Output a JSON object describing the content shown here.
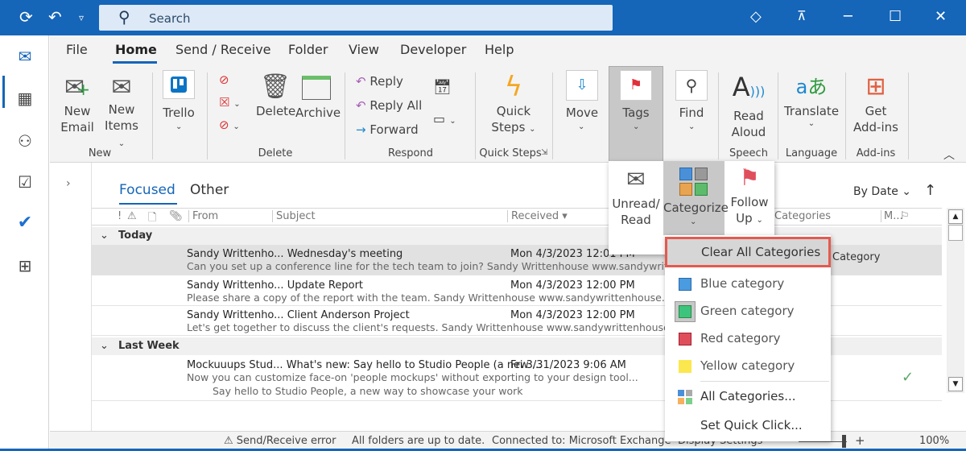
{
  "titlebar": {
    "search_placeholder": "Search",
    "icons": [
      "sync-icon",
      "undo-icon",
      "customize-icon",
      "premium-diamond-icon",
      "coming-soon-icon",
      "minimize-icon",
      "maximize-icon",
      "close-icon"
    ]
  },
  "rail": [
    "mail",
    "calendar",
    "people",
    "tasks",
    "todo",
    "apps"
  ],
  "menu_tabs": [
    "File",
    "Home",
    "Send / Receive",
    "Folder",
    "View",
    "Developer",
    "Help"
  ],
  "active_tab": "Home",
  "ribbon": {
    "new_email": [
      "New",
      "Email"
    ],
    "new_items": [
      "New",
      "Items"
    ],
    "trello": "Trello",
    "delete": "Delete",
    "archive": "Archive",
    "reply": "Reply",
    "reply_all": "Reply All",
    "forward": "Forward",
    "quick_steps": [
      "Quick",
      "Steps"
    ],
    "move": "Move",
    "tags": "Tags",
    "find": "Find",
    "read_aloud": [
      "Read",
      "Aloud"
    ],
    "translate": "Translate",
    "get_addins": [
      "Get",
      "Add-ins"
    ],
    "groups": [
      "New",
      "Delete",
      "Respond",
      "Quick Steps",
      "Speech",
      "Language",
      "Add-ins"
    ]
  },
  "tags_panel": {
    "unread_read": [
      "Unread/",
      "Read"
    ],
    "categorize": "Categorize",
    "follow_up": [
      "Follow",
      "Up"
    ]
  },
  "category_menu": {
    "clear_all": "Clear All Categories",
    "items": [
      {
        "label": "Blue category",
        "color": "#4a9be0"
      },
      {
        "label": "Green category",
        "color": "#3cc47c"
      },
      {
        "label": "Red category",
        "color": "#e04e5c"
      },
      {
        "label": "Yellow category",
        "color": "#fbe74e"
      }
    ],
    "all_categories": "All Categories...",
    "set_quick_click": "Set Quick Click..."
  },
  "mail_list": {
    "tabs": [
      "Focused",
      "Other"
    ],
    "active_tab": "Focused",
    "sort": "By Date",
    "columns": [
      "From",
      "Subject",
      "Received",
      "Categories",
      "M..."
    ],
    "groups": [
      {
        "label": "Today",
        "messages": [
          {
            "from": "Sandy Writtenho...",
            "subject": "Wednesday's meeting",
            "received": "Mon 4/3/2023 12:01 PM",
            "preview": "Can you set up a conference line for the tech team to join?  Sandy Writtenhouse  www.sandywrittenhouse.com",
            "category": "Category",
            "selected": true
          },
          {
            "from": "Sandy Writtenho...",
            "subject": "Update Report",
            "received": "Mon 4/3/2023 12:00 PM",
            "preview": "Please share a copy of the report with the team.  Sandy Writtenhouse  www.sandywrittenhouse.com  @"
          },
          {
            "from": "Sandy Writtenho...",
            "subject": "Client Anderson Project",
            "received": "Mon 4/3/2023 12:00 PM",
            "preview": "Let's get together to discuss the client's requests.  Sandy Writtenhouse  www.sandywrittenhouse.com"
          }
        ]
      },
      {
        "label": "Last Week",
        "messages": [
          {
            "from": "Mockuuups Stud...",
            "subject": "What's new: Say hello to Studio People (a new ...",
            "received": "Fri 3/31/2023 9:06 AM",
            "preview": "Now you can customize face-on 'people mockups' without exporting to your design tool...",
            "preview2": "Say hello to Studio People, a new way to showcase your work",
            "done": true
          }
        ]
      }
    ]
  },
  "status": {
    "error": "Send/Receive error",
    "folders": "All folders are up to date.",
    "connection": "Connected to: Microsoft Exchange",
    "display_settings": "Display Settings",
    "zoom": "100%"
  }
}
